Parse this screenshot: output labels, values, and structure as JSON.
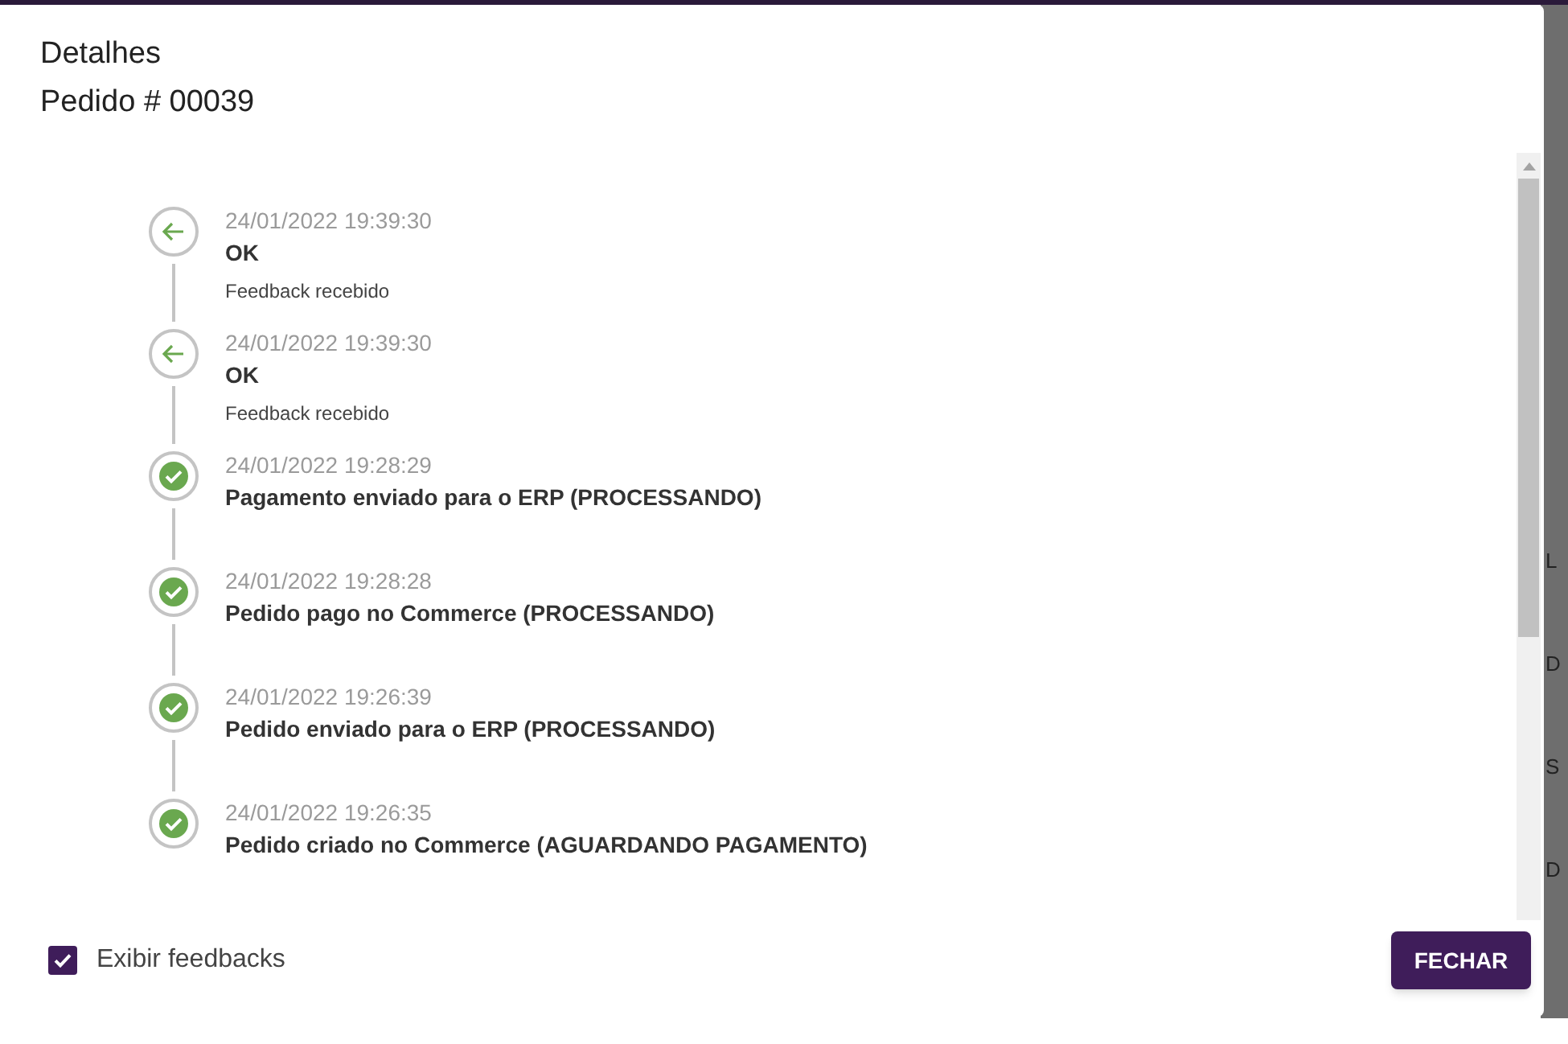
{
  "dialog": {
    "title": "Detalhes",
    "subtitle": "Pedido # 00039"
  },
  "timeline": [
    {
      "kind": "feedback",
      "time": "24/01/2022 19:39:30",
      "title": "OK",
      "note": "Feedback recebido"
    },
    {
      "kind": "feedback",
      "time": "24/01/2022 19:39:30",
      "title": "OK",
      "note": "Feedback recebido"
    },
    {
      "kind": "status",
      "time": "24/01/2022 19:28:29",
      "title": "Pagamento enviado para o ERP (PROCESSANDO)"
    },
    {
      "kind": "status",
      "time": "24/01/2022 19:28:28",
      "title": "Pedido pago no Commerce (PROCESSANDO)"
    },
    {
      "kind": "status",
      "time": "24/01/2022 19:26:39",
      "title": "Pedido enviado para o ERP (PROCESSANDO)"
    },
    {
      "kind": "status",
      "time": "24/01/2022 19:26:35",
      "title": "Pedido criado no Commerce (AGUARDANDO PAGAMENTO)"
    }
  ],
  "show_feedbacks": {
    "label": "Exibir feedbacks",
    "checked": true
  },
  "close_button": "FECHAR",
  "background_cells": [
    "L",
    "D",
    "S",
    "D"
  ]
}
